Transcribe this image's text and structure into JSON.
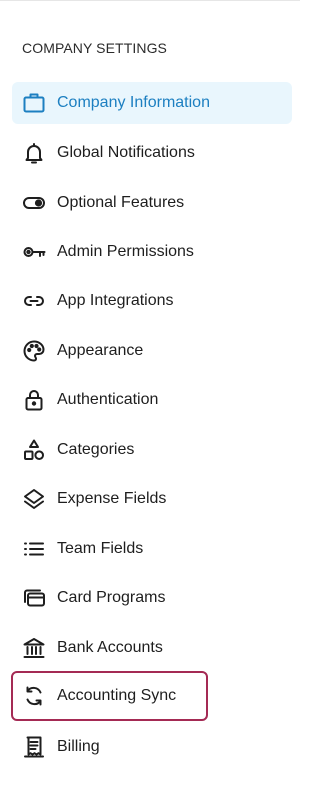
{
  "sidebar": {
    "section_title": "COMPANY SETTINGS",
    "items": [
      {
        "label": "Company Information",
        "icon": "briefcase-icon",
        "active": true
      },
      {
        "label": "Global Notifications",
        "icon": "bell-icon"
      },
      {
        "label": "Optional Features",
        "icon": "toggle-icon"
      },
      {
        "label": "Admin Permissions",
        "icon": "key-icon"
      },
      {
        "label": "App Integrations",
        "icon": "link-icon"
      },
      {
        "label": "Appearance",
        "icon": "palette-icon"
      },
      {
        "label": "Authentication",
        "icon": "lock-icon"
      },
      {
        "label": "Categories",
        "icon": "shapes-icon"
      },
      {
        "label": "Expense Fields",
        "icon": "layers-icon"
      },
      {
        "label": "Team Fields",
        "icon": "list-icon"
      },
      {
        "label": "Card Programs",
        "icon": "cards-icon"
      },
      {
        "label": "Bank Accounts",
        "icon": "bank-icon"
      },
      {
        "label": "Accounting Sync",
        "icon": "sync-icon",
        "highlighted": true
      },
      {
        "label": "Billing",
        "icon": "receipt-icon"
      }
    ]
  },
  "colors": {
    "accent": "#1c7fc1",
    "active_bg": "#e9f6fd",
    "highlight_border": "#a42a54"
  }
}
